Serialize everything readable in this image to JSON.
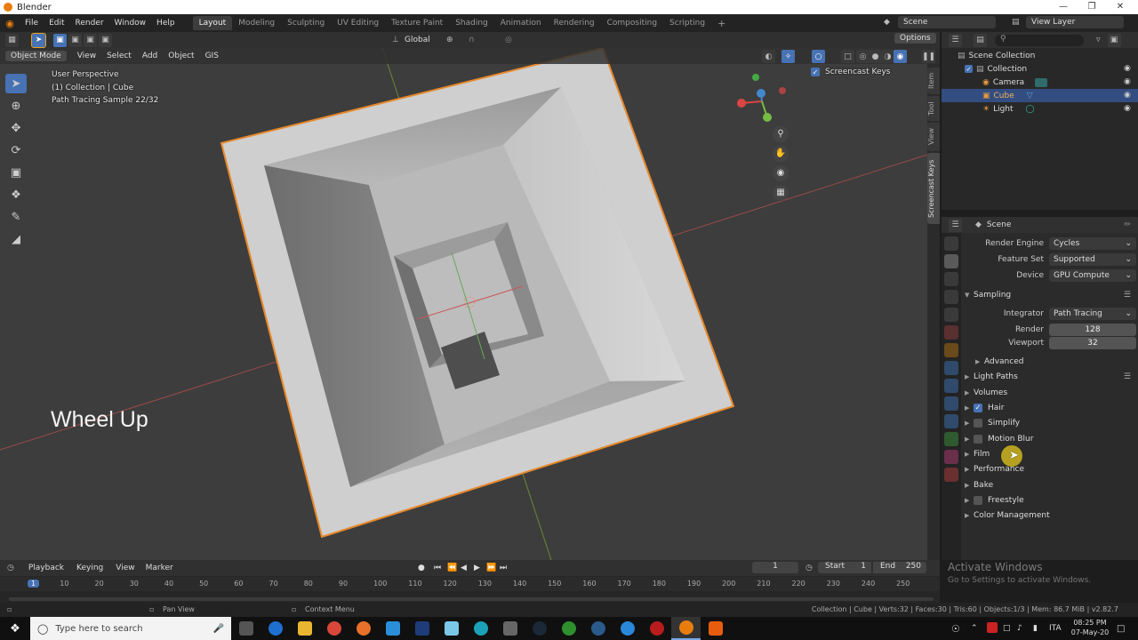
{
  "window": {
    "title": "Blender"
  },
  "menu": [
    "File",
    "Edit",
    "Render",
    "Window",
    "Help"
  ],
  "workspaces": [
    "Layout",
    "Modeling",
    "Sculpting",
    "UV Editing",
    "Texture Paint",
    "Shading",
    "Animation",
    "Rendering",
    "Compositing",
    "Scripting"
  ],
  "scene_name": "Scene",
  "view_layer": "View Layer",
  "header": {
    "transform": "Global",
    "options": "Options",
    "mode": "Object Mode",
    "view": "View",
    "select": "Select",
    "add": "Add",
    "object": "Object",
    "gis": "GIS"
  },
  "viewport": {
    "line1": "User Perspective",
    "line2": "(1) Collection | Cube",
    "line3": "Path Tracing Sample 22/32",
    "screencast": "Screencast Keys",
    "key_overlay": "Wheel Up"
  },
  "side_tabs": [
    "Item",
    "Tool",
    "View",
    "Screencast Keys"
  ],
  "outliner": {
    "root": "Scene Collection",
    "collection": "Collection",
    "items": [
      "Camera",
      "Cube",
      "Light"
    ]
  },
  "properties": {
    "context": "Scene",
    "render_engine_label": "Render Engine",
    "render_engine": "Cycles",
    "feature_set_label": "Feature Set",
    "feature_set": "Supported",
    "device_label": "Device",
    "device": "GPU Compute",
    "sampling": "Sampling",
    "integrator_label": "Integrator",
    "integrator": "Path Tracing",
    "render_label": "Render",
    "render_value": "128",
    "viewport_label": "Viewport",
    "viewport_value": "32",
    "advanced": "Advanced",
    "sections": [
      "Light Paths",
      "Volumes",
      "Hair",
      "Simplify",
      "Motion Blur",
      "Film",
      "Performance",
      "Bake",
      "Freestyle",
      "Color Management"
    ]
  },
  "timeline": {
    "playback": "Playback",
    "keying": "Keying",
    "view": "View",
    "marker": "Marker",
    "current_frame": "1",
    "start_label": "Start",
    "start": "1",
    "end_label": "End",
    "end": "250",
    "ruler": [
      "1",
      "10",
      "20",
      "30",
      "40",
      "50",
      "60",
      "70",
      "80",
      "90",
      "100",
      "110",
      "120",
      "130",
      "140",
      "150",
      "160",
      "170",
      "180",
      "190",
      "200",
      "210",
      "220",
      "230",
      "240",
      "250"
    ]
  },
  "watermark": {
    "line1": "Activate Windows",
    "line2": "Go to Settings to activate Windows."
  },
  "status": {
    "pan": "Pan View",
    "context": "Context Menu",
    "info": "Collection | Cube | Verts:32 | Faces:30 | Tris:60 | Objects:1/3 | Mem: 86.7 MiB | v2.82.7"
  },
  "taskbar": {
    "search": "Type here to search",
    "lang": "ITA",
    "time": "08:25 PM",
    "date": "07-May-20"
  }
}
